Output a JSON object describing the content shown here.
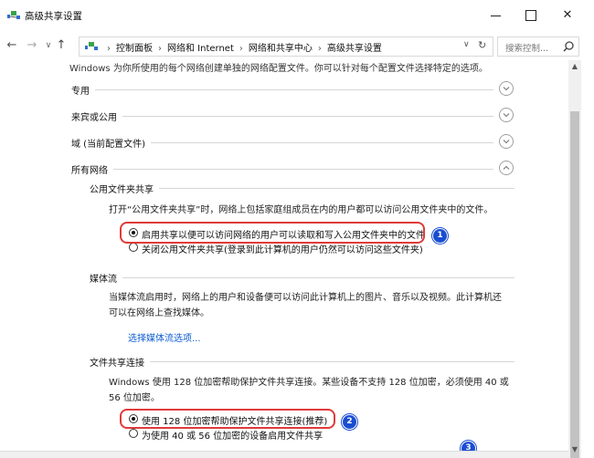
{
  "window": {
    "title": "高级共享设置",
    "minimize": "–",
    "maximize": "□",
    "close": "✕"
  },
  "nav": {
    "back": "←",
    "forward": "→",
    "recent": "∨",
    "up": "↑",
    "refresh": "↻",
    "dropdown": "∨"
  },
  "address": {
    "crumbs": [
      "控制面板",
      "网络和 Internet",
      "网络和共享中心",
      "高级共享设置"
    ],
    "separator": "›"
  },
  "search": {
    "placeholder": "搜索控制..."
  },
  "content": {
    "top_text": "Windows 为你所使用的每个网络创建单独的网络配置文件。你可以针对每个配置文件选择特定的选项。",
    "profiles": [
      {
        "label": "专用",
        "state": "collapsed"
      },
      {
        "label": "来宾或公用",
        "state": "collapsed"
      },
      {
        "label": "域 (当前配置文件)",
        "state": "collapsed"
      },
      {
        "label": "所有网络",
        "state": "expanded"
      }
    ],
    "public_folder": {
      "heading": "公用文件夹共享",
      "desc": "打开“公用文件夹共享”时，网络上包括家庭组成员在内的用户都可以访问公用文件夹中的文件。",
      "option_on": "启用共享以便可以访问网络的用户可以读取和写入公用文件夹中的文件",
      "option_off": "关闭公用文件夹共享(登录到此计算机的用户仍然可以访问这些文件夹)",
      "selected": "on"
    },
    "media": {
      "heading": "媒体流",
      "desc_line1": "当媒体流启用时，网络上的用户和设备便可以访问此计算机上的图片、音乐以及视频。此计算机还",
      "desc_line2": "可以在网络上查找媒体。",
      "link": "选择媒体流选项..."
    },
    "file_sharing": {
      "heading": "文件共享连接",
      "desc_line1": "Windows 使用 128 位加密帮助保护文件共享连接。某些设备不支持 128 位加密，必须使用 40 或",
      "desc_line2": "56 位加密。",
      "option_128": "使用 128 位加密帮助保护文件共享连接(推荐)",
      "option_40": "为使用 40 或 56 位加密的设备启用文件共享",
      "selected": "128"
    }
  },
  "callouts": [
    "1",
    "2",
    "3"
  ],
  "colors": {
    "callout_border": "#e03a3a",
    "badge": "#1a4dd1",
    "link": "#0b5bd3"
  }
}
